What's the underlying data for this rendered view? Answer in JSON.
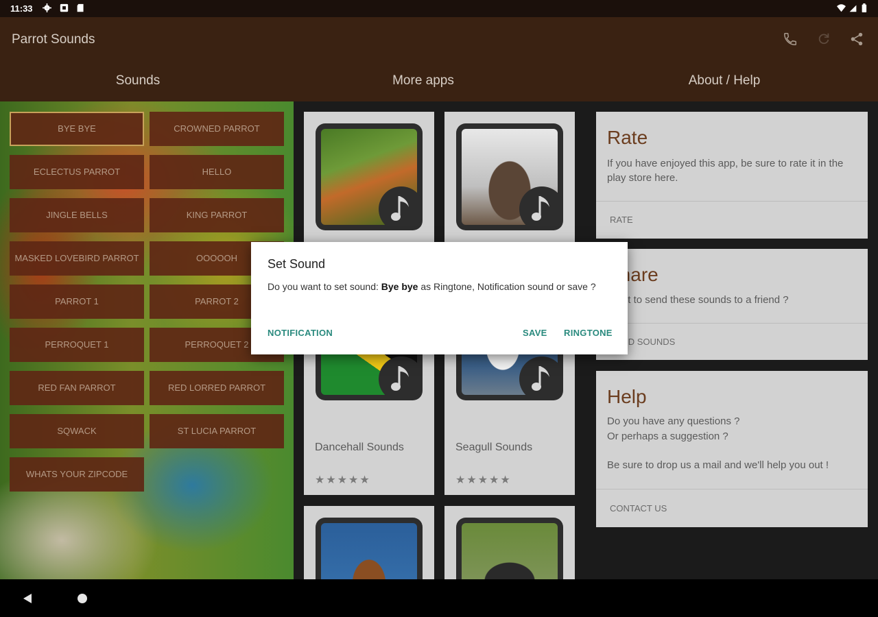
{
  "status_bar": {
    "time": "11:33",
    "icons": [
      "settings-icon",
      "notification-icon",
      "sd-card-icon",
      "wifi-icon",
      "signal-icon",
      "battery-icon"
    ]
  },
  "app_bar": {
    "title": "Parrot Sounds",
    "actions": [
      "phone-icon",
      "refresh-icon",
      "share-icon"
    ]
  },
  "tabs": [
    {
      "label": "Sounds"
    },
    {
      "label": "More apps"
    },
    {
      "label": "About / Help"
    }
  ],
  "sounds": [
    {
      "label": "BYE BYE",
      "selected": true
    },
    {
      "label": "CROWNED PARROT"
    },
    {
      "label": "ECLECTUS PARROT"
    },
    {
      "label": "HELLO"
    },
    {
      "label": "JINGLE BELLS"
    },
    {
      "label": "KING PARROT"
    },
    {
      "label": "MASKED LOVEBIRD PARROT"
    },
    {
      "label": "OOOOOH"
    },
    {
      "label": "PARROT 1"
    },
    {
      "label": "PARROT 2"
    },
    {
      "label": "PERROQUET 1"
    },
    {
      "label": "PERROQUET 2"
    },
    {
      "label": "RED FAN PARROT"
    },
    {
      "label": "RED LORRED PARROT"
    },
    {
      "label": "SQWACK"
    },
    {
      "label": "ST LUCIA PARROT"
    },
    {
      "label": "WHATS YOUR ZIPCODE"
    }
  ],
  "more_apps": [
    {
      "title": "",
      "image": "rooster",
      "stars": "★★★★★"
    },
    {
      "title": "",
      "image": "deer",
      "stars": "★★★★★"
    },
    {
      "title": "Dancehall Sounds",
      "image": "jamaica-flag",
      "stars": "★★★★★"
    },
    {
      "title": "Seagull Sounds",
      "image": "seagull",
      "stars": "★★★★★"
    },
    {
      "title": "",
      "image": "horse",
      "stars": ""
    },
    {
      "title": "",
      "image": "buffalo",
      "stars": ""
    }
  ],
  "about": {
    "rate": {
      "title": "Rate",
      "text": "If you have enjoyed this app, be sure to rate it in the play store here.",
      "action": "RATE"
    },
    "share": {
      "title": "Share",
      "text": "Want to send these sounds to a friend ?",
      "action": "SEND SOUNDS"
    },
    "help": {
      "title": "Help",
      "line1": "Do you have any questions ?",
      "line2": "Or perhaps a suggestion ?",
      "line3": "Be sure to drop us a mail and we'll help you out !",
      "action": "CONTACT US"
    }
  },
  "dialog": {
    "title": "Set Sound",
    "msg_prefix": "Do you want to set sound: ",
    "sound_name": "Bye bye",
    "msg_suffix": " as Ringtone, Notification sound or save ?",
    "btn_notification": "NOTIFICATION",
    "btn_save": "SAVE",
    "btn_ringtone": "RINGTONE"
  },
  "nav_bar": {
    "icons": [
      "back-icon",
      "home-icon"
    ]
  },
  "colors": {
    "app_bar": "#3a2212",
    "status_bar": "#1b100b",
    "accent": "#2a8a7e",
    "button_bg": "#5f2814",
    "card_bg": "#d2d2d2",
    "info_title": "#6b3d1f"
  }
}
